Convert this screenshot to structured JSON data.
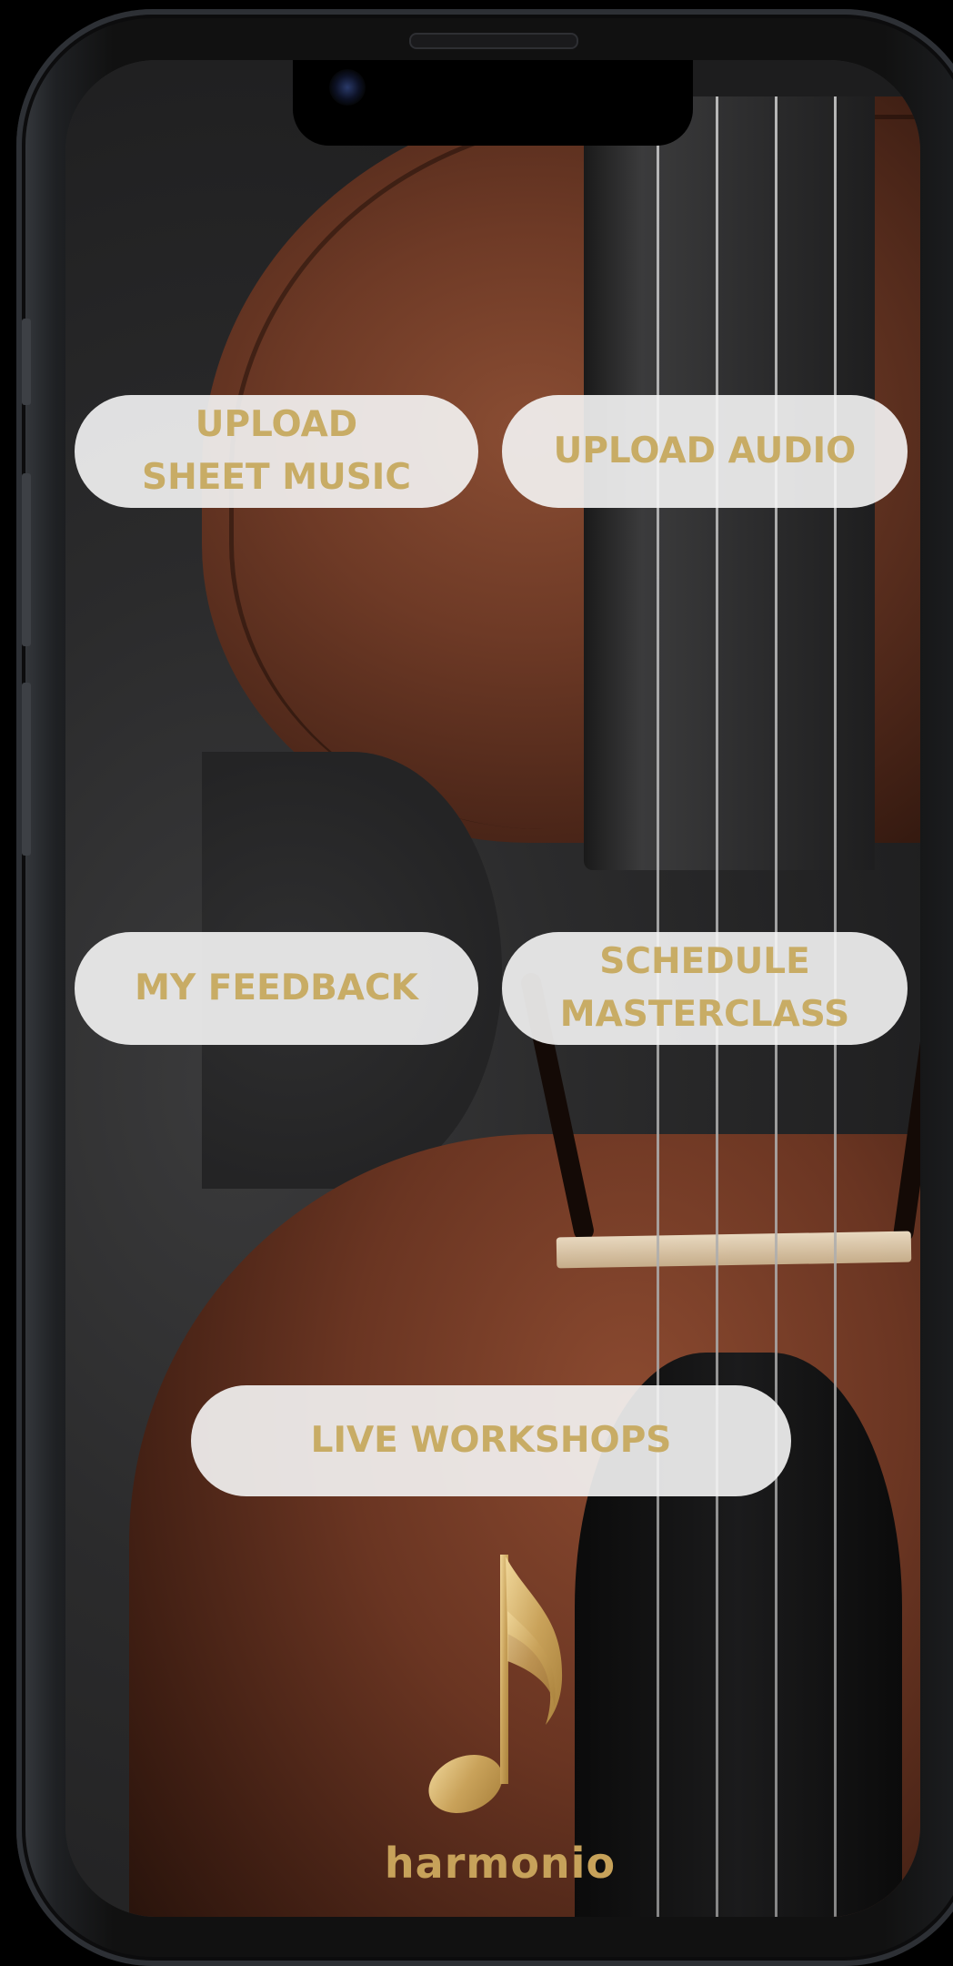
{
  "buttons": {
    "upload_sheet_music": "UPLOAD\nSHEET MUSIC",
    "upload_audio": "UPLOAD AUDIO",
    "my_feedback": "MY FEEDBACK",
    "schedule_masterclass": "SCHEDULE\nMASTERCLASS",
    "live_workshops": "LIVE WORKSHOPS"
  },
  "brand": {
    "name": "harmonio",
    "logo_icon": "eighth-note-icon"
  },
  "colors": {
    "accent_gold": "#c8ac65",
    "button_bg": "#f5f5f5"
  }
}
